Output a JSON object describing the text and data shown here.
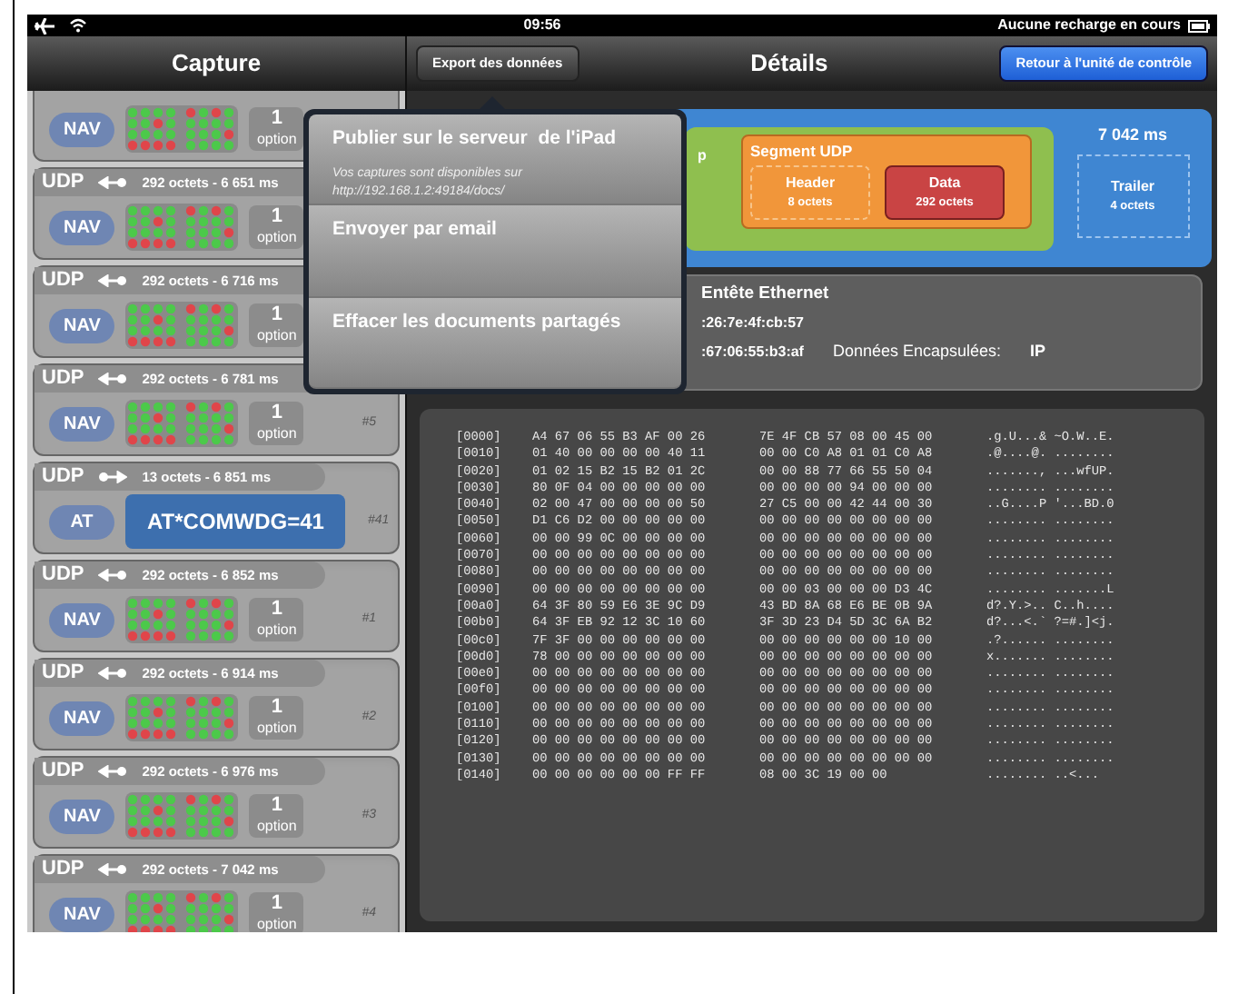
{
  "status_bar": {
    "time": "09:56",
    "charging": "Aucune recharge en cours"
  },
  "capture": {
    "title": "Capture",
    "packets": [
      {
        "kind": "partial",
        "tag": "NAV",
        "count": "1",
        "count_label": "option"
      },
      {
        "kind": "nav",
        "protocol": "UDP",
        "incoming": true,
        "info": "292 octets - 6 651 ms",
        "tag": "NAV",
        "count": "1",
        "count_label": "option"
      },
      {
        "kind": "nav",
        "protocol": "UDP",
        "incoming": true,
        "info": "292 octets - 6 716 ms",
        "tag": "NAV",
        "count": "1",
        "count_label": "option"
      },
      {
        "kind": "nav",
        "protocol": "UDP",
        "incoming": true,
        "info": "292 octets - 6 781 ms",
        "tag": "NAV",
        "count": "1",
        "count_label": "option",
        "number": "#5"
      },
      {
        "kind": "at",
        "protocol": "UDP",
        "incoming": false,
        "info": "13 octets - 6 851 ms",
        "tag": "AT",
        "command": "AT*COMWDG=41",
        "number": "#41"
      },
      {
        "kind": "nav",
        "protocol": "UDP",
        "incoming": true,
        "info": "292 octets - 6 852 ms",
        "tag": "NAV",
        "count": "1",
        "count_label": "option",
        "number": "#1"
      },
      {
        "kind": "nav",
        "protocol": "UDP",
        "incoming": true,
        "info": "292 octets - 6 914 ms",
        "tag": "NAV",
        "count": "1",
        "count_label": "option",
        "number": "#2"
      },
      {
        "kind": "nav",
        "protocol": "UDP",
        "incoming": true,
        "info": "292 octets - 6 976 ms",
        "tag": "NAV",
        "count": "1",
        "count_label": "option",
        "number": "#3"
      },
      {
        "kind": "nav",
        "protocol": "UDP",
        "incoming": true,
        "info": "292 octets - 7 042 ms",
        "tag": "NAV",
        "count": "1",
        "count_label": "option",
        "number": "#4"
      }
    ]
  },
  "details": {
    "title": "Détails",
    "export_button": "Export des données",
    "back_button": "Retour à l'unité de contrôle",
    "frame": {
      "time": "7 042 ms",
      "packet_label": "p",
      "segment": {
        "title": "Segment UDP",
        "parts": [
          {
            "label": "Header",
            "size": "8 octets",
            "selected": false
          },
          {
            "label": "Data",
            "size": "292 octets",
            "selected": true
          }
        ]
      },
      "trailer": {
        "label": "Trailer",
        "size": "4 octets"
      }
    },
    "ethernet": {
      "title": "Entête Ethernet",
      "destination": ":26:7e:4f:cb:57",
      "source": ":67:06:55:b3:af",
      "encapsulated_label": "Données Encapsulées:",
      "encapsulated_value": "IP"
    },
    "hex_rows": [
      [
        "[0000]",
        "A4 67 06 55 B3 AF 00 26",
        "7E 4F CB 57 08 00 45 00",
        ".g.U...& ~O.W..E."
      ],
      [
        "[0010]",
        "01 40 00 00 00 00 40 11",
        "00 00 C0 A8 01 01 C0 A8",
        ".@....@. ........"
      ],
      [
        "[0020]",
        "01 02 15 B2 15 B2 01 2C",
        "00 00 88 77 66 55 50 04",
        "......., ...wfUP."
      ],
      [
        "[0030]",
        "80 0F 04 00 00 00 00 00",
        "00 00 00 00 94 00 00 00",
        "........ ........"
      ],
      [
        "[0040]",
        "02 00 47 00 00 00 00 50",
        "27 C5 00 00 42 44 00 30",
        "..G....P '...BD.0"
      ],
      [
        "[0050]",
        "D1 C6 D2 00 00 00 00 00",
        "00 00 00 00 00 00 00 00",
        "........ ........"
      ],
      [
        "[0060]",
        "00 00 99 0C 00 00 00 00",
        "00 00 00 00 00 00 00 00",
        "........ ........"
      ],
      [
        "[0070]",
        "00 00 00 00 00 00 00 00",
        "00 00 00 00 00 00 00 00",
        "........ ........"
      ],
      [
        "[0080]",
        "00 00 00 00 00 00 00 00",
        "00 00 00 00 00 00 00 00",
        "........ ........"
      ],
      [
        "[0090]",
        "00 00 00 00 00 00 00 00",
        "00 00 03 00 00 00 D3 4C",
        "........ .......L"
      ],
      [
        "[00a0]",
        "64 3F 80 59 E6 3E 9C D9",
        "43 BD 8A 68 E6 BE 0B 9A",
        "d?.Y.>.. C..h...."
      ],
      [
        "[00b0]",
        "64 3F EB 92 12 3C 10 60",
        "3F 3D 23 D4 5D 3C 6A B2",
        "d?...<.` ?=#.]<j."
      ],
      [
        "[00c0]",
        "7F 3F 00 00 00 00 00 00",
        "00 00 00 00 00 00 10 00",
        ".?...... ........"
      ],
      [
        "[00d0]",
        "78 00 00 00 00 00 00 00",
        "00 00 00 00 00 00 00 00",
        "x....... ........"
      ],
      [
        "[00e0]",
        "00 00 00 00 00 00 00 00",
        "00 00 00 00 00 00 00 00",
        "........ ........"
      ],
      [
        "[00f0]",
        "00 00 00 00 00 00 00 00",
        "00 00 00 00 00 00 00 00",
        "........ ........"
      ],
      [
        "[0100]",
        "00 00 00 00 00 00 00 00",
        "00 00 00 00 00 00 00 00",
        "........ ........"
      ],
      [
        "[0110]",
        "00 00 00 00 00 00 00 00",
        "00 00 00 00 00 00 00 00",
        "........ ........"
      ],
      [
        "[0120]",
        "00 00 00 00 00 00 00 00",
        "00 00 00 00 00 00 00 00",
        "........ ........"
      ],
      [
        "[0130]",
        "00 00 00 00 00 00 00 00",
        "00 00 00 00 00 00 00 00",
        "........ ........"
      ],
      [
        "[0140]",
        "00 00 00 00 00 00 FF FF",
        "08 00 3C 19 00 00",
        "........ ..<..."
      ]
    ]
  },
  "popover": {
    "items": [
      {
        "label": "Publier sur le serveur  de l'iPad",
        "note": "Vos captures sont disponibles sur http://192.168.1.2:49184/docs/"
      },
      {
        "label": "Envoyer par email"
      },
      {
        "label": "Effacer les documents partagés"
      }
    ]
  }
}
